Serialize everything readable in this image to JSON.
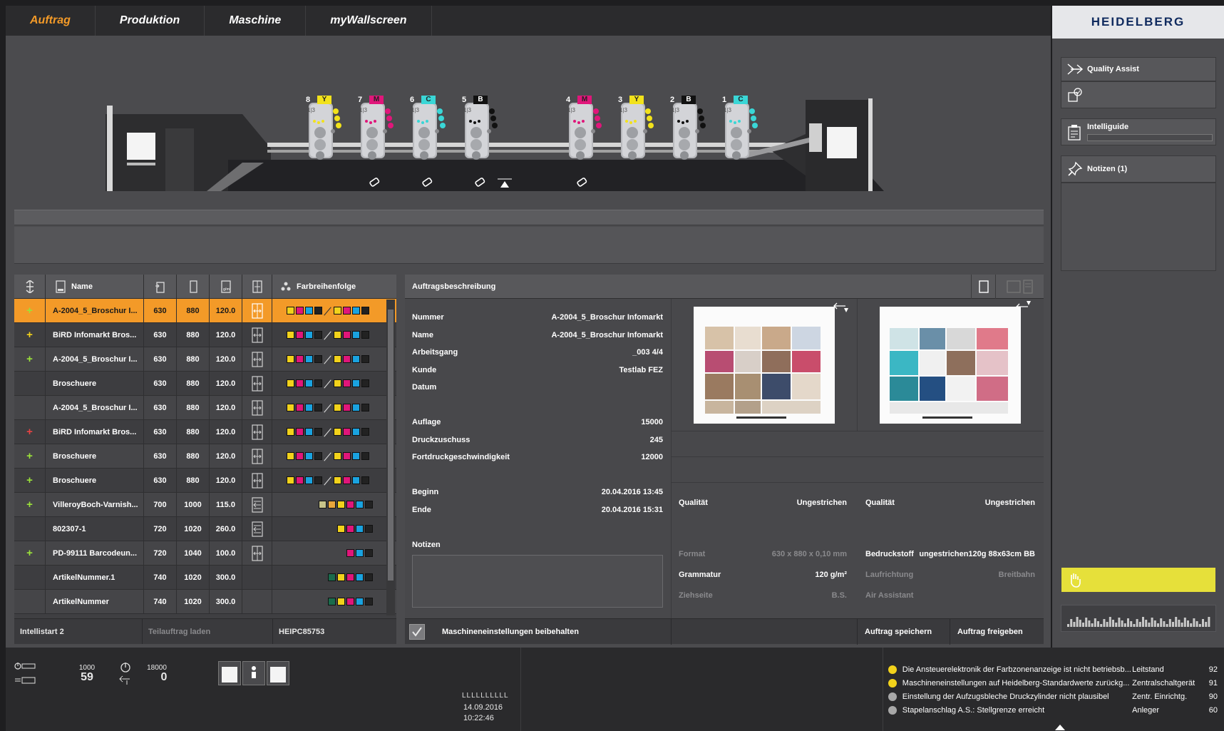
{
  "nav": {
    "tabs": [
      {
        "label": "Auftrag",
        "active": true
      },
      {
        "label": "Produktion",
        "active": false
      },
      {
        "label": "Maschine",
        "active": false
      },
      {
        "label": "myWallscreen",
        "active": false
      }
    ],
    "brand": "HEIDELBERG"
  },
  "press": {
    "units": [
      {
        "num": "8",
        "color": "Y"
      },
      {
        "num": "7",
        "color": "M"
      },
      {
        "num": "6",
        "color": "C"
      },
      {
        "num": "5",
        "color": "B"
      },
      {
        "num": "4",
        "color": "M"
      },
      {
        "num": "3",
        "color": "Y"
      },
      {
        "num": "2",
        "color": "B"
      },
      {
        "num": "1",
        "color": "C"
      }
    ],
    "unit_sub": "1|3"
  },
  "joblist": {
    "headers": {
      "name": "Name",
      "color_order": "Farbreihenfolge"
    },
    "rows": [
      {
        "status": "+",
        "status_color": "#9be23a",
        "name": "A-2004_5_Broschur I...",
        "w": "630",
        "h": "880",
        "g": "120.0",
        "icon": "turn",
        "colors": [
          "#f2d21b",
          "#e0167a",
          "#1aa3e0",
          "#222222",
          "/",
          "#f2d21b",
          "#e0167a",
          "#1aa3e0",
          "#222222"
        ]
      },
      {
        "status": "+",
        "status_color": "#f2d21b",
        "name": "BiRD Infomarkt Bros...",
        "w": "630",
        "h": "880",
        "g": "120.0",
        "icon": "turn",
        "colors": [
          "#f2d21b",
          "#e0167a",
          "#1aa3e0",
          "#222222",
          "/",
          "#f2d21b",
          "#e0167a",
          "#1aa3e0",
          "#222222"
        ]
      },
      {
        "status": "+",
        "status_color": "#9be23a",
        "name": "A-2004_5_Broschur I...",
        "w": "630",
        "h": "880",
        "g": "120.0",
        "icon": "turn",
        "colors": [
          "#f2d21b",
          "#e0167a",
          "#1aa3e0",
          "#222222",
          "/",
          "#f2d21b",
          "#e0167a",
          "#1aa3e0",
          "#222222"
        ]
      },
      {
        "status": "",
        "status_color": "#9be23a",
        "name": "Broschuere",
        "w": "630",
        "h": "880",
        "g": "120.0",
        "icon": "turn",
        "colors": [
          "#f2d21b",
          "#e0167a",
          "#1aa3e0",
          "#222222",
          "/",
          "#f2d21b",
          "#e0167a",
          "#1aa3e0",
          "#222222"
        ]
      },
      {
        "status": "",
        "status_color": "#9be23a",
        "name": "A-2004_5_Broschur I...",
        "w": "630",
        "h": "880",
        "g": "120.0",
        "icon": "turn",
        "colors": [
          "#f2d21b",
          "#e0167a",
          "#1aa3e0",
          "#222222",
          "/",
          "#f2d21b",
          "#e0167a",
          "#1aa3e0",
          "#222222"
        ]
      },
      {
        "status": "+",
        "status_color": "#e84343",
        "name": "BiRD Infomarkt Bros...",
        "w": "630",
        "h": "880",
        "g": "120.0",
        "icon": "turn",
        "colors": [
          "#f2d21b",
          "#e0167a",
          "#1aa3e0",
          "#222222",
          "/",
          "#f2d21b",
          "#e0167a",
          "#1aa3e0",
          "#222222"
        ]
      },
      {
        "status": "+",
        "status_color": "#9be23a",
        "name": "Broschuere",
        "w": "630",
        "h": "880",
        "g": "120.0",
        "icon": "turn",
        "colors": [
          "#f2d21b",
          "#e0167a",
          "#1aa3e0",
          "#222222",
          "/",
          "#f2d21b",
          "#e0167a",
          "#1aa3e0",
          "#222222"
        ]
      },
      {
        "status": "+",
        "status_color": "#9be23a",
        "name": "Broschuere",
        "w": "630",
        "h": "880",
        "g": "120.0",
        "icon": "turn",
        "colors": [
          "#f2d21b",
          "#e0167a",
          "#1aa3e0",
          "#222222",
          "/",
          "#f2d21b",
          "#e0167a",
          "#1aa3e0",
          "#222222"
        ]
      },
      {
        "status": "+",
        "status_color": "#9be23a",
        "name": "VilleroyBoch-Varnish...",
        "w": "700",
        "h": "1000",
        "g": "115.0",
        "icon": "straight",
        "colors": [
          "#c8c48a",
          "#e8a63c",
          "#f2d21b",
          "#e0167a",
          "#1aa3e0",
          "#222222"
        ]
      },
      {
        "status": "",
        "status_color": "#9be23a",
        "name": "802307-1",
        "w": "720",
        "h": "1020",
        "g": "260.0",
        "icon": "straight",
        "colors": [
          "#f2d21b",
          "#e0167a",
          "#1aa3e0",
          "#222222"
        ]
      },
      {
        "status": "+",
        "status_color": "#9be23a",
        "name": "PD-99111 Barcodeun...",
        "w": "720",
        "h": "1040",
        "g": "100.0",
        "icon": "turn",
        "colors": [
          "#e0167a",
          "#1aa3e0",
          "#222222"
        ]
      },
      {
        "status": "",
        "status_color": "#9be23a",
        "name": "ArtikelNummer.1",
        "w": "740",
        "h": "1020",
        "g": "300.0",
        "icon": "",
        "colors": [
          "#1a6b4c",
          "#f2d21b",
          "#e0167a",
          "#1aa3e0",
          "#222222"
        ]
      },
      {
        "status": "",
        "status_color": "#9be23a",
        "name": "ArtikelNummer",
        "w": "740",
        "h": "1020",
        "g": "300.0",
        "icon": "",
        "colors": [
          "#1a6b4c",
          "#f2d21b",
          "#e0167a",
          "#1aa3e0",
          "#222222"
        ]
      }
    ],
    "footer": {
      "intellistart": "Intellistart 2",
      "teilauftrag": "Teilauftrag laden",
      "device": "HEIPC85753"
    }
  },
  "desc": {
    "title": "Auftragsbeschreibung",
    "fields": [
      {
        "label": "Nummer",
        "value": "A-2004_5_Broschur Infomarkt"
      },
      {
        "label": "Name",
        "value": "A-2004_5_Broschur Infomarkt"
      },
      {
        "label": "Arbeitsgang",
        "value": "_003 4/4"
      },
      {
        "label": "Kunde",
        "value": "Testlab FEZ"
      },
      {
        "label": "Datum",
        "value": ""
      }
    ],
    "fields2": [
      {
        "label": "Auflage",
        "value": "15000"
      },
      {
        "label": "Druckzuschuss",
        "value": "245"
      },
      {
        "label": "Fortdruckgeschwindigkeit",
        "value": "12000"
      }
    ],
    "fields3": [
      {
        "label": "Beginn",
        "value": "20.04.2016 13:45"
      },
      {
        "label": "Ende",
        "value": "20.04.2016 15:31"
      }
    ],
    "notes_label": "Notizen",
    "paper_left": [
      {
        "label": "Qualität",
        "value": "Ungestrichen",
        "dim": false
      },
      {
        "label": "Format",
        "value": "630 x 880 x 0,10 mm",
        "dim": true
      },
      {
        "label": "Grammatur",
        "value": "120 g/m²",
        "dim": false
      },
      {
        "label": "Ziehseite",
        "value": "B.S.",
        "dim": true
      }
    ],
    "paper_right": [
      {
        "label": "Qualität",
        "value": "Ungestrichen",
        "dim": false
      },
      {
        "label": "Bedruckstoff",
        "value": "ungestrichen120g 88x63cm BB",
        "dim": false
      },
      {
        "label": "Laufrichtung",
        "value": "Breitbahn",
        "dim": true
      },
      {
        "label": "Air Assistant",
        "value": "",
        "dim": true
      }
    ],
    "footer": {
      "keep_settings": "Maschineneinstellungen beibehalten",
      "save": "Auftrag speichern",
      "release": "Auftrag freigeben"
    }
  },
  "rightpanel": {
    "quality_assist": "Quality Assist",
    "intelliguide": "Intelliguide",
    "notizen": "Notizen (1)"
  },
  "bottom": {
    "counter1_top": "1000",
    "counter1": "59",
    "counter2_top": "18000",
    "counter2": "0",
    "ruler": "LLLLLLLLLL",
    "date": "14.09.2016",
    "time": "10:22:46",
    "messages": [
      {
        "text": "Die Ansteuerelektronik der Farbzonenanzeige ist nicht betriebsb...",
        "source": "Leitstand",
        "num": "92",
        "color": "#f2d21b"
      },
      {
        "text": "Maschineneinstellungen auf Heidelberg-Standardwerte zurückg...",
        "source": "Zentralschaltgerät",
        "num": "91",
        "color": "#f2d21b"
      },
      {
        "text": "Einstellung der Aufzugsbleche Druckzylinder nicht plausibel",
        "source": "Zentr. Einrichtg.",
        "num": "90",
        "color": "#a8a8a8"
      },
      {
        "text": "Stapelanschlag A.S.: Stellgrenze erreicht",
        "source": "Anleger",
        "num": "60",
        "color": "#a8a8a8"
      }
    ]
  },
  "colors": {
    "accent": "#f39a28",
    "yellow_bar": "#e6e03a"
  }
}
